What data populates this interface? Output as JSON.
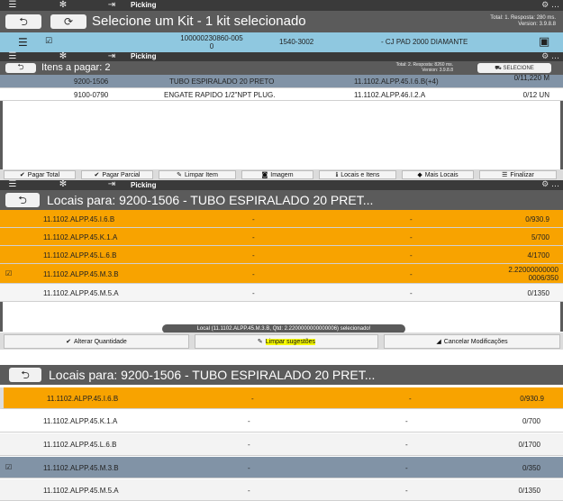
{
  "panel1": {
    "sysbar_title": "Picking",
    "title": "Selecione um Kit - 1 kit selecionado",
    "meta_line1": "Total: 1. Resposta: 280 ms.",
    "meta_line2": "Version: 3.9.8.8",
    "kit": {
      "code_line1": "100000230860-005",
      "code_line2": "0",
      "ref": "1540-3002",
      "description": "- CJ PAD 2000 DIAMANTE"
    }
  },
  "panel2": {
    "sysbar_title": "Picking",
    "title": "Itens a pagar: 2",
    "meta_line1": "Total: 2. Resposta: 8260 ms.",
    "meta_line2": "Version: 3.9.8.8",
    "select_button": "SELECIONE",
    "items": [
      {
        "code": "9200-1506",
        "desc": "TUBO ESPIRALADO 20 PRETO",
        "loc": "11.1102.ALPP.45.I.6.B(+4)",
        "qty": "0/11,220 M"
      },
      {
        "code": "9100-0790",
        "desc": "ENGATE RAPIDO 1/2\"NPT PLUG.",
        "loc": "11.1102.ALPP.46.I.2.A",
        "qty": "0/12 UN"
      }
    ],
    "buttons": [
      "Pagar Total",
      "Pagar Parcial",
      "Limpar Item",
      "Imagem",
      "Locais e Itens",
      "Mais Locais",
      "Finalizar"
    ]
  },
  "panel3": {
    "sysbar_title": "Picking",
    "title": "Locais para: 9200-1506 - TUBO ESPIRALADO 20 PRET...",
    "rows": [
      {
        "loc": "11.1102.ALPP.45.I.6.B",
        "c2": "-",
        "c3": "-",
        "qty": "0/930.9",
        "checked": false
      },
      {
        "loc": "11.1102.ALPP.45.K.1.A",
        "c2": "-",
        "c3": "-",
        "qty": "5/700",
        "checked": false
      },
      {
        "loc": "11.1102.ALPP.45.L.6.B",
        "c2": "-",
        "c3": "-",
        "qty": "4/1700",
        "checked": false
      },
      {
        "loc": "11.1102.ALPP.45.M.3.B",
        "c2": "-",
        "c3": "-",
        "qty_line1": "2.22000000000",
        "qty_line2": "0006/350",
        "checked": true
      },
      {
        "loc": "11.1102.ALPP.45.M.5.A",
        "c2": "-",
        "c3": "-",
        "qty": "0/1350",
        "checked": false
      }
    ],
    "toast": "Local (11.1102.ALPP.45.M.3.B, Qtd: 2.2200000000000006) selecionado!",
    "buttons": [
      "Alterar Quantidade",
      "Limpar sugestões",
      "Cancelar Modificações"
    ]
  },
  "panel4": {
    "title": "Locais para: 9200-1506 - TUBO ESPIRALADO 20 PRET...",
    "rows": [
      {
        "loc": "11.1102.ALPP.45.I.6.B",
        "c2": "-",
        "c3": "-",
        "qty": "0/930.9",
        "checked": false
      },
      {
        "loc": "11.1102.ALPP.45.K.1.A",
        "c2": "-",
        "c3": "-",
        "qty": "0/700",
        "checked": false
      },
      {
        "loc": "11.1102.ALPP.45.L.6.B",
        "c2": "-",
        "c3": "-",
        "qty": "0/1700",
        "checked": false
      },
      {
        "loc": "11.1102.ALPP.45.M.3.B",
        "c2": "-",
        "c3": "-",
        "qty": "0/350",
        "checked": true
      },
      {
        "loc": "11.1102.ALPP.45.M.5.A",
        "c2": "-",
        "c3": "-",
        "qty": "0/1350",
        "checked": false
      }
    ]
  },
  "colors": {
    "selected_orange": "#f8a300",
    "selected_steel": "#8193a6",
    "kit_bar": "#8fc8e0"
  }
}
